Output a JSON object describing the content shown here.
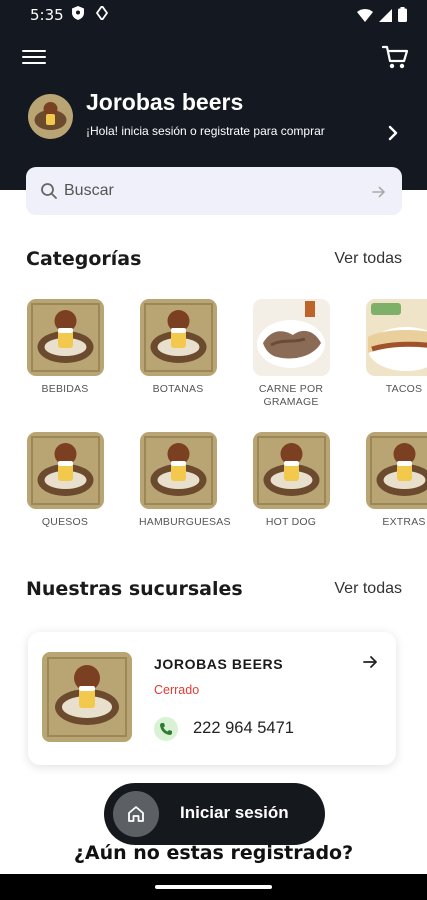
{
  "status_bar": {
    "time": "5:35"
  },
  "header": {
    "brand_name": "Jorobas beers",
    "subtitle": "¡Hola! inicia sesión o registrate para comprar"
  },
  "search": {
    "placeholder": "Buscar"
  },
  "categories": {
    "title": "Categorías",
    "see_all": "Ver todas",
    "items": [
      {
        "label": "BEBIDAS",
        "image": "logo"
      },
      {
        "label": "BOTANAS",
        "image": "logo"
      },
      {
        "label": "CARNE POR GRAMAGE",
        "image": "meat"
      },
      {
        "label": "TACOS",
        "image": "tacos"
      },
      {
        "label": "QUESOS",
        "image": "logo"
      },
      {
        "label": "HAMBURGUESAS",
        "image": "logo"
      },
      {
        "label": "HOT DOG",
        "image": "logo"
      },
      {
        "label": "EXTRAS",
        "image": "logo"
      }
    ]
  },
  "branches": {
    "title": "Nuestras sucursales",
    "see_all": "Ver todas",
    "items": [
      {
        "name": "JOROBAS BEERS",
        "status": "Cerrado",
        "phone": "222 964 5471"
      }
    ]
  },
  "login_button": {
    "label": "Iniciar sesión"
  },
  "register_prompt": "¿Aún no estas registrado?",
  "colors": {
    "header_bg": "#141820",
    "search_bg": "#f0f0fa",
    "status_closed": "#e53935",
    "phone_icon_bg": "#d9f2d6",
    "login_bg": "#15181d"
  },
  "icons": [
    "menu-icon",
    "cart-icon",
    "chevron-right-icon",
    "search-icon",
    "arrow-right-icon",
    "phone-icon",
    "home-icon"
  ]
}
